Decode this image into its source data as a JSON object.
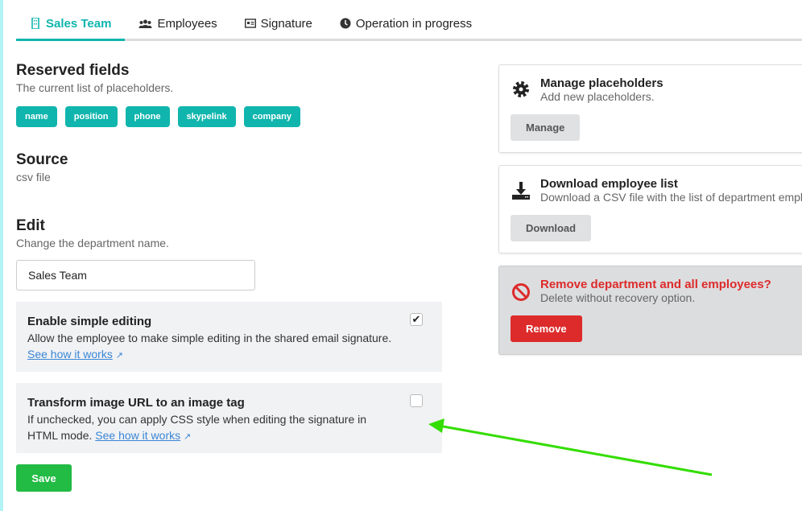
{
  "tabs": [
    {
      "label": "Sales Team",
      "icon": "building-icon",
      "active": true
    },
    {
      "label": "Employees",
      "icon": "users-icon"
    },
    {
      "label": "Signature",
      "icon": "id-card-icon"
    },
    {
      "label": "Operation in progress",
      "icon": "clock-icon"
    }
  ],
  "reserved": {
    "title": "Reserved fields",
    "subtitle": "The current list of placeholders.",
    "tags": [
      "name",
      "position",
      "phone",
      "skypelink",
      "company"
    ]
  },
  "source": {
    "title": "Source",
    "value": "csv file"
  },
  "edit": {
    "title": "Edit",
    "subtitle": "Change the department name.",
    "name_value": "Sales Team"
  },
  "options": [
    {
      "title": "Enable simple editing",
      "desc": "Allow the employee to make simple editing in the shared email signature.",
      "link": "See how it works",
      "checked": true
    },
    {
      "title": "Transform image URL to an image tag",
      "desc": "If unchecked, you can apply CSS style when editing the signature in HTML mode.",
      "link": "See how it works",
      "checked": false
    }
  ],
  "save_label": "Save",
  "cards": {
    "manage": {
      "title": "Manage placeholders",
      "desc": "Add new placeholders.",
      "button": "Manage"
    },
    "download": {
      "title": "Download employee list",
      "desc": "Download a CSV file with the list of department empl",
      "button": "Download"
    },
    "remove": {
      "title": "Remove department and all employees?",
      "desc": "Delete without recovery option.",
      "button": "Remove"
    }
  },
  "colors": {
    "accent": "#10b5ad",
    "danger": "#dd2b2b",
    "save": "#22bb44",
    "arrow": "#33dd00"
  }
}
